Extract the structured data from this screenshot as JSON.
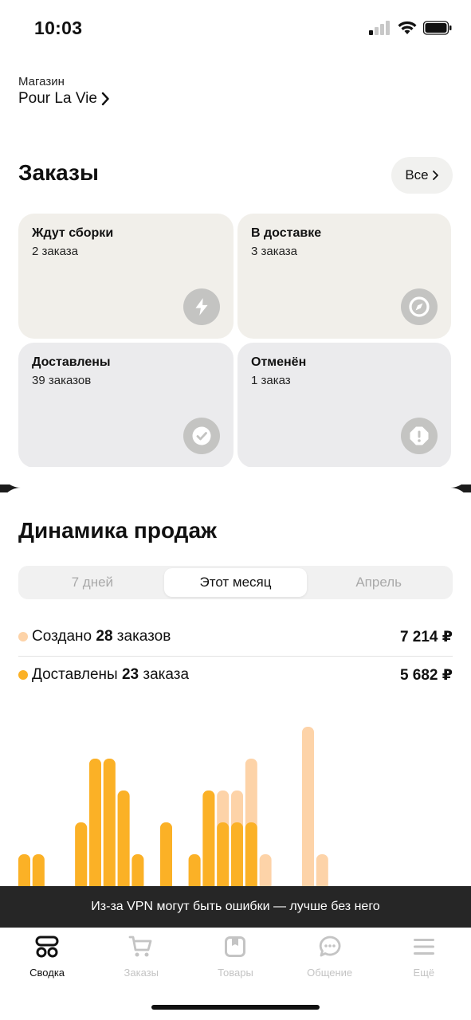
{
  "status_bar": {
    "time": "10:03"
  },
  "store": {
    "label": "Магазин",
    "name": "Pour La Vie"
  },
  "orders": {
    "title": "Заказы",
    "all_label": "Все",
    "cards": [
      {
        "title": "Ждут сборки",
        "count": "2 заказа",
        "icon": "lightning-icon"
      },
      {
        "title": "В доставке",
        "count": "3 заказа",
        "icon": "compass-icon"
      },
      {
        "title": "Доставлены",
        "count": "39 заказов",
        "icon": "check-icon"
      },
      {
        "title": "Отменён",
        "count": "1 заказ",
        "icon": "alert-icon"
      }
    ]
  },
  "sales": {
    "title": "Динамика продаж",
    "periods": [
      "7 дней",
      "Этот месяц",
      "Апрель"
    ],
    "active_period": "Этот месяц",
    "created": {
      "prefix": "Создано",
      "count": "28",
      "suffix": "заказов",
      "amount": "7 214 ₽"
    },
    "delivered": {
      "prefix": "Доставлены",
      "count": "23",
      "suffix": "заказа",
      "amount": "5 682 ₽"
    }
  },
  "chart_data": {
    "type": "bar",
    "series": [
      {
        "values": [
          1,
          1,
          0,
          0,
          2,
          4,
          4,
          3,
          1,
          0,
          2,
          0,
          1,
          3,
          3,
          3,
          4,
          1,
          0,
          0,
          5,
          1
        ],
        "color": "#fdd3a8"
      },
      {
        "values": [
          1,
          1,
          0,
          0,
          2,
          4,
          4,
          3,
          1,
          0,
          2,
          0,
          1,
          3,
          2,
          2,
          2,
          0,
          0,
          0,
          0,
          0
        ],
        "color": "#fbb126"
      }
    ]
  },
  "vpn_banner": {
    "text": "Из-за VPN могут быть ошибки — лучше без него"
  },
  "tabbar": {
    "active": "Сводка",
    "items": [
      {
        "label": "Сводка",
        "icon": "dashboard-icon"
      },
      {
        "label": "Заказы",
        "icon": "cart-icon"
      },
      {
        "label": "Товары",
        "icon": "box-icon"
      },
      {
        "label": "Общение",
        "icon": "chat-icon"
      },
      {
        "label": "Ещё",
        "icon": "menu-icon"
      }
    ]
  },
  "colors": {
    "accent": "#fbb126",
    "accent_light": "#fdd3a8",
    "card_warm": "#f1efea",
    "card_grey": "#ebebed"
  }
}
